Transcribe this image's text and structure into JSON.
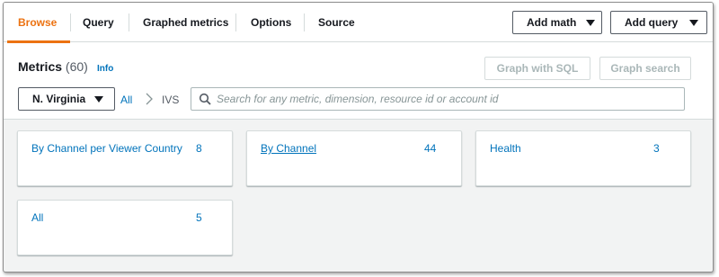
{
  "tabs": [
    {
      "label": "Browse",
      "active": true
    },
    {
      "label": "Query"
    },
    {
      "label": "Graphed metrics"
    },
    {
      "label": "Options"
    },
    {
      "label": "Source"
    }
  ],
  "actions": {
    "add_math": "Add math",
    "add_query": "Add query"
  },
  "header": {
    "title": "Metrics",
    "count": "(60)",
    "info": "Info",
    "graph_sql": "Graph with SQL",
    "graph_search": "Graph search"
  },
  "filter": {
    "region": "N. Virginia",
    "breadcrumb_all": "All",
    "breadcrumb_current": "IVS",
    "search_placeholder": "Search for any metric, dimension, resource id or account id"
  },
  "cards": [
    {
      "label": "By Channel per Viewer Country",
      "count": "8"
    },
    {
      "label": "By Channel",
      "count": "44"
    },
    {
      "label": "Health",
      "count": "3"
    },
    {
      "label": "All",
      "count": "5"
    }
  ],
  "colors": {
    "accent": "#ec7211",
    "link": "#0073bb",
    "background": "#f2f3f3"
  }
}
